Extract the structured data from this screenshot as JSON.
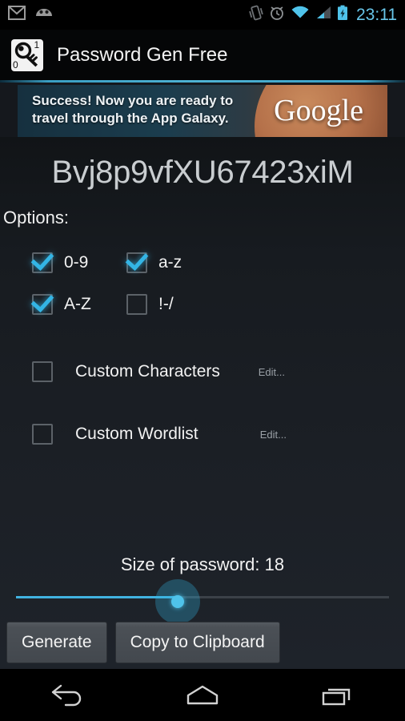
{
  "status_bar": {
    "icons_left": [
      "gmail-icon",
      "android-mascot-icon"
    ],
    "icons_right": [
      "vibrate-icon",
      "alarm-icon",
      "wifi-icon",
      "signal-icon",
      "battery-charging-icon"
    ],
    "time": "23:11",
    "time_color": "#68c6ea"
  },
  "title_bar": {
    "app_icon": "password-key-icon",
    "title": "Password Gen Free",
    "accent_color": "#4fb3d4"
  },
  "ad": {
    "line1": "Success! Now you are ready to",
    "line2": "travel through the App Galaxy.",
    "brand": "Google",
    "image": "mars-planet-image"
  },
  "main": {
    "password": "Bvj8p9vfXU67423xiM",
    "options_label": "Options:",
    "checkbox_rows": [
      [
        {
          "label": "0-9",
          "checked": true
        },
        {
          "label": "a-z",
          "checked": true
        }
      ],
      [
        {
          "label": "A-Z",
          "checked": true
        },
        {
          "label": "!-/",
          "checked": false
        }
      ]
    ],
    "custom_options": [
      {
        "label": "Custom Characters",
        "checked": false,
        "edit_label": "Edit..."
      },
      {
        "label": "Custom Wordlist",
        "checked": false,
        "edit_label": "Edit..."
      }
    ],
    "slider": {
      "label": "Size of password: 18",
      "value": 18,
      "fill_percent": 43,
      "accent_color": "#33b5e5"
    },
    "buttons": [
      {
        "label": "Generate"
      },
      {
        "label": "Copy to Clipboard"
      }
    ]
  },
  "nav_bar": {
    "buttons": [
      "back-icon",
      "home-icon",
      "recents-icon"
    ]
  }
}
